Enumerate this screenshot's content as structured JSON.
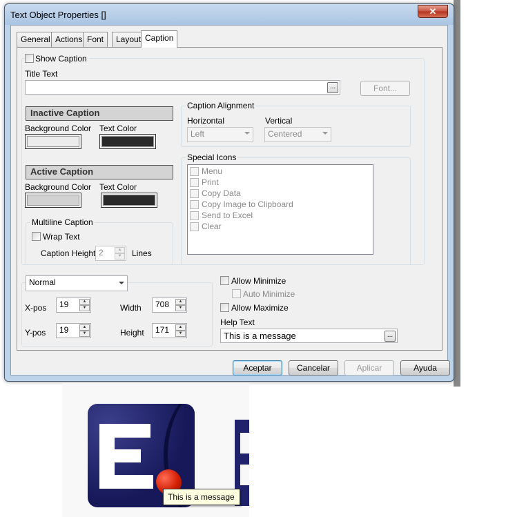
{
  "window": {
    "title": "Text Object Properties []",
    "close_glyph": "✕"
  },
  "tabs": [
    {
      "label": "General"
    },
    {
      "label": "Actions"
    },
    {
      "label": "Font"
    },
    {
      "label": "Layout"
    },
    {
      "label": "Caption"
    }
  ],
  "caption": {
    "show_caption_label": "Show Caption",
    "title_text_label": "Title Text",
    "title_text_value": "",
    "ellipsis": "...",
    "font_button": "Font...",
    "inactive": {
      "header": "Inactive Caption",
      "bg_label": "Background Color",
      "text_label": "Text Color",
      "bg_color": "#ececec",
      "text_color": "#2a2a2a"
    },
    "active": {
      "header": "Active Caption",
      "bg_label": "Background Color",
      "text_label": "Text Color",
      "bg_color": "#d2d2d2",
      "text_color": "#2a2a2a"
    },
    "alignment": {
      "title": "Caption Alignment",
      "horizontal_label": "Horizontal",
      "horizontal_value": "Left",
      "vertical_label": "Vertical",
      "vertical_value": "Centered"
    },
    "multiline": {
      "title": "Multiline Caption",
      "wrap_label": "Wrap Text",
      "height_label": "Caption Height",
      "height_value": "2",
      "lines_label": "Lines"
    },
    "special_icons": {
      "title": "Special Icons",
      "items": [
        "Menu",
        "Print",
        "Copy Data",
        "Copy Image to Clipboard",
        "Send to Excel",
        "Clear"
      ]
    }
  },
  "bottom": {
    "state_value": "Normal",
    "xpos_label": "X-pos",
    "xpos_value": "19",
    "ypos_label": "Y-pos",
    "ypos_value": "19",
    "width_label": "Width",
    "width_value": "708",
    "height_label": "Height",
    "height_value": "171",
    "allow_minimize": "Allow Minimize",
    "auto_minimize": "Auto Minimize",
    "allow_maximize": "Allow Maximize",
    "help_text_label": "Help Text",
    "help_text_value": "This is a message"
  },
  "buttons": {
    "ok": "Aceptar",
    "cancel": "Cancelar",
    "apply": "Aplicar",
    "help": "Ayuda"
  },
  "tooltip": "This is a message"
}
